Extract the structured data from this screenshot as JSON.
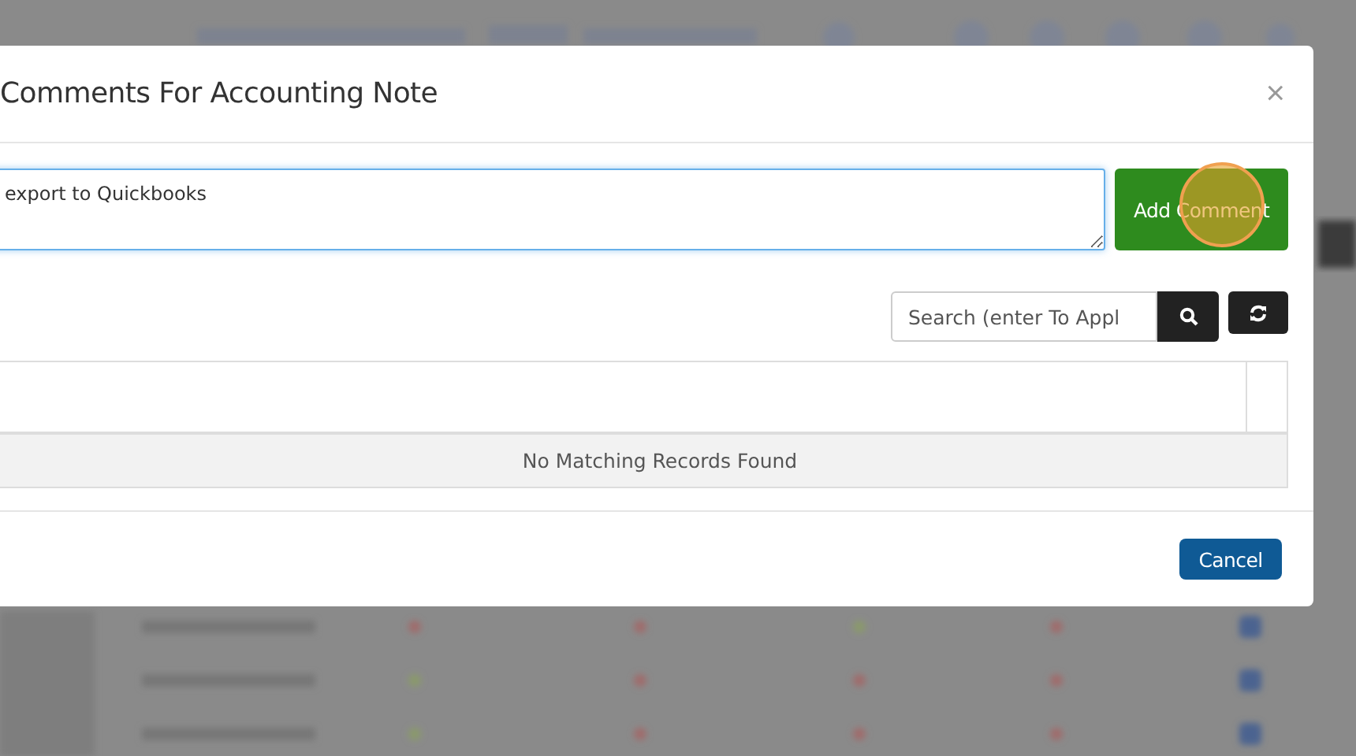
{
  "modal": {
    "title": "Comments For Accounting Note",
    "close": "×",
    "comment": {
      "value": "export to Quickbooks"
    },
    "add_button": "Add Comment",
    "search": {
      "placeholder": "Search (enter To Appl"
    },
    "table": {
      "empty_message": "No Matching Records Found"
    },
    "buttons": [
      "Cancel"
    ]
  }
}
